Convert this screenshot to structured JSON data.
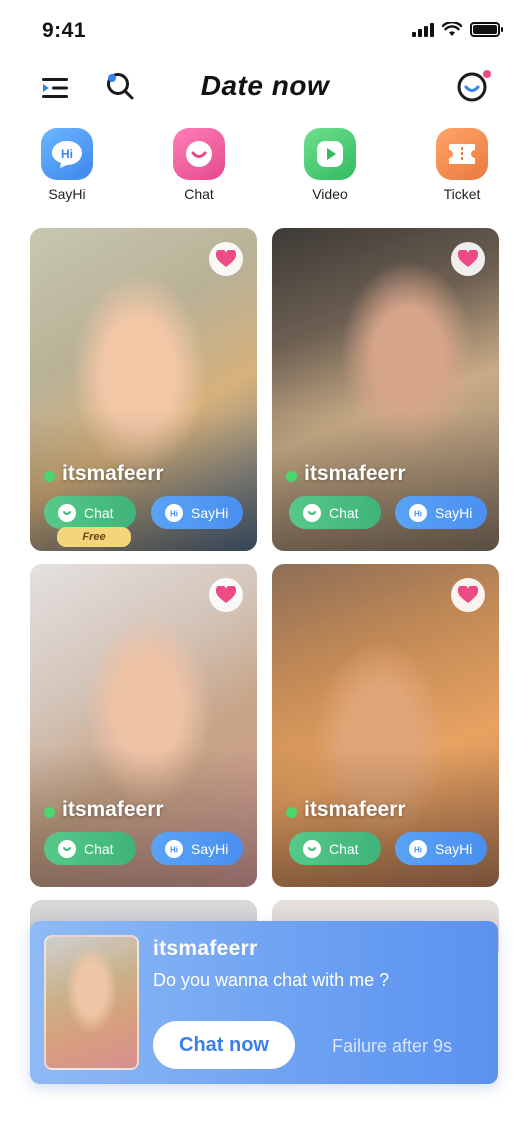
{
  "status_bar": {
    "time": "9:41"
  },
  "header": {
    "title": "Date now"
  },
  "quick_actions": [
    {
      "label": "SayHi",
      "icon": "hi-bubble-icon",
      "color": "#4a9af3"
    },
    {
      "label": "Chat",
      "icon": "smile-bubble-icon",
      "color": "#ee5d9a"
    },
    {
      "label": "Video",
      "icon": "play-icon",
      "color": "#3dcb6d"
    },
    {
      "label": "Ticket",
      "icon": "ticket-icon",
      "color": "#f08a4f"
    }
  ],
  "cards": [
    {
      "name": "itsmafeerr",
      "chat_label": "Chat",
      "sayhi_label": "SayHi",
      "free_tag": "Free",
      "online": true,
      "favorited": true
    },
    {
      "name": "itsmafeerr",
      "chat_label": "Chat",
      "sayhi_label": "SayHi",
      "online": true,
      "favorited": true
    },
    {
      "name": "itsmafeerr",
      "chat_label": "Chat",
      "sayhi_label": "SayHi",
      "online": true,
      "favorited": true
    },
    {
      "name": "itsmafeerr",
      "chat_label": "Chat",
      "sayhi_label": "SayHi",
      "online": true,
      "favorited": true
    }
  ],
  "popup": {
    "name": "itsmafeerr",
    "message": "Do you wanna chat with me ?",
    "chat_now_label": "Chat now",
    "failure_text": "Failure after 9s"
  },
  "colors": {
    "heart": "#ee4b86",
    "online": "#49d76e",
    "chat_button": "#4cbf84",
    "sayhi_button": "#5299f3",
    "popup_gradient_start": "#8fbaf5",
    "popup_gradient_end": "#5a92f0"
  }
}
